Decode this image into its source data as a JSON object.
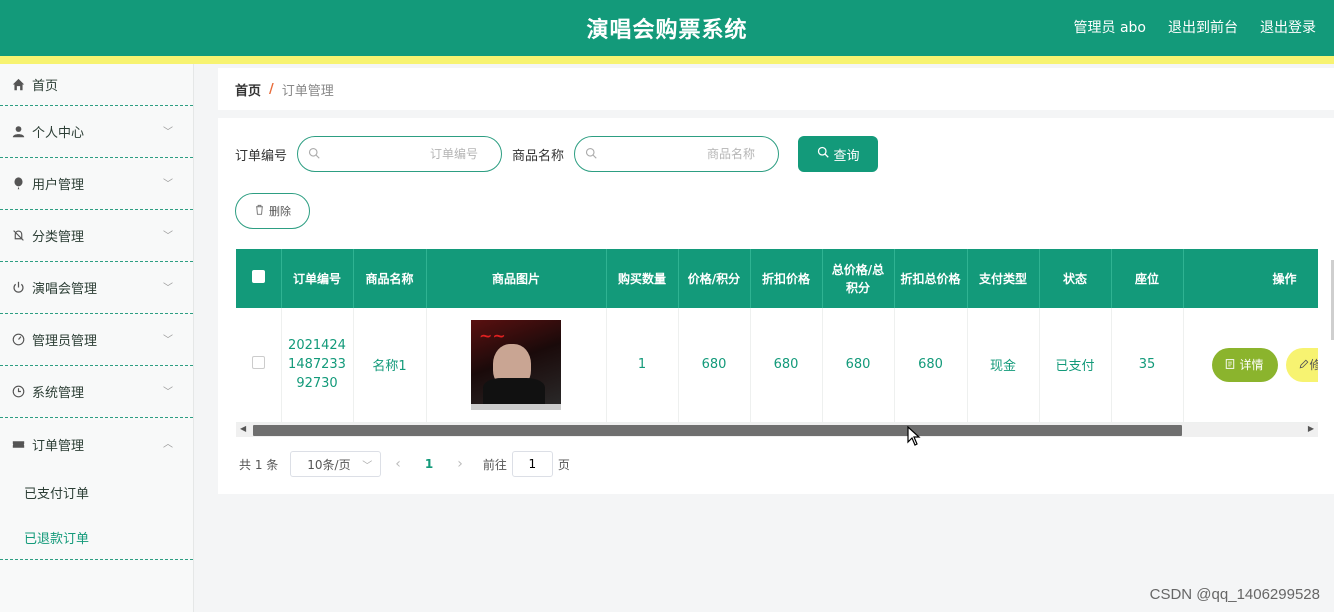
{
  "header": {
    "title": "演唱会购票系统",
    "admin": "管理员 abo",
    "back_front": "退出到前台",
    "logout": "退出登录"
  },
  "sidebar": {
    "items": [
      {
        "label": "首页",
        "icon": "home-icon"
      },
      {
        "label": "个人中心",
        "icon": "user-icon"
      },
      {
        "label": "用户管理",
        "icon": "balloon-icon"
      },
      {
        "label": "分类管理",
        "icon": "bell-off-icon"
      },
      {
        "label": "演唱会管理",
        "icon": "power-icon"
      },
      {
        "label": "管理员管理",
        "icon": "gauge-icon"
      },
      {
        "label": "系统管理",
        "icon": "clock-icon"
      },
      {
        "label": "订单管理",
        "icon": "ticket-icon"
      }
    ],
    "sub_items": [
      {
        "label": "已支付订单"
      },
      {
        "label": "已退款订单"
      }
    ]
  },
  "breadcrumb": {
    "home": "首页",
    "separator": "/",
    "current": "订单管理"
  },
  "search": {
    "order_label": "订单编号",
    "order_placeholder": "订单编号",
    "product_label": "商品名称",
    "product_placeholder": "商品名称",
    "query_button": "查询"
  },
  "actions": {
    "delete_button": "删除"
  },
  "table": {
    "headers": [
      "订单编号",
      "商品名称",
      "商品图片",
      "购买数量",
      "价格/积分",
      "折扣价格",
      "总价格/总积分",
      "折扣总价格",
      "支付类型",
      "状态",
      "座位",
      "操作"
    ],
    "rows": [
      {
        "order_no": "20214241487233 92730",
        "product_name": "名称1",
        "quantity": "1",
        "price": "680",
        "discount_price": "680",
        "total_price": "680",
        "discount_total": "680",
        "pay_type": "现金",
        "status": "已支付",
        "seat": "35",
        "detail_button": "详情",
        "edit_button": "修"
      }
    ]
  },
  "pagination": {
    "total": "共 1 条",
    "page_size": "10条/页",
    "current_page": "1",
    "goto_label": "前往",
    "goto_value": "1",
    "page_suffix": "页"
  },
  "watermark": "CSDN @qq_1406299528",
  "colors": {
    "primary": "#139a7a",
    "accent_yellow": "#f7f371",
    "detail_green": "#8bb42d"
  }
}
